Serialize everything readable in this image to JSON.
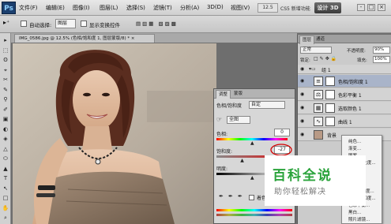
{
  "app": {
    "logo_text": "Ps",
    "menu": [
      "文件(F)",
      "编辑(E)",
      "图像(I)",
      "图层(L)",
      "选择(S)",
      "滤镜(T)",
      "分析(A)",
      "3D(D)",
      "视图(V)"
    ],
    "zoom": "12.5",
    "version_label": "CS5 新增功能",
    "workspace_label": "设计 3D",
    "window_buttons": [
      "-",
      "□",
      "×"
    ]
  },
  "options_bar": {
    "tool_icon": "move-tool-icon",
    "auto_select_label": "自动选择:",
    "auto_select_value": "图层",
    "show_transform_label": "显示变换控件"
  },
  "document": {
    "tab_title": "IMG_0586.jpg @ 12.5% (色相/饱和度 1, 图层蒙版/8) * ×"
  },
  "toolbox": {
    "tools": [
      "▸",
      "⬚",
      "ʘ",
      "⌖",
      "✂",
      "✎",
      "⚲",
      "✐",
      "▣",
      "◐",
      "◈",
      "△",
      "⬭",
      "▲",
      "T",
      "↖",
      "□",
      "✋",
      "⌕"
    ]
  },
  "adjustments": {
    "tabs": [
      "调整",
      "蒙版"
    ],
    "preset_label": "色相/饱和度",
    "preset_value": "自定",
    "channel_value": "全图",
    "hue_label": "色相:",
    "hue_value": "0",
    "saturation_label": "饱和度:",
    "saturation_value": "-27",
    "saturation_fraction": 0.37,
    "lightness_label": "明度:",
    "lightness_value": "0",
    "colorize_label": "着色",
    "highlight_color": "#d40000"
  },
  "layers": {
    "tabs": [
      "图层",
      "通道"
    ],
    "blend_mode": "正常",
    "opacity_label": "不透明度:",
    "opacity_value": "90%",
    "lock_label": "锁定:",
    "fill_label": "填充:",
    "fill_value": "100%",
    "group_name": "组 1",
    "items": [
      {
        "name": "色相/饱和度 1",
        "thumb": "≡",
        "selected": true
      },
      {
        "name": "色彩平衡 1",
        "thumb": "⚖",
        "selected": false
      },
      {
        "name": "选取颜色 1",
        "thumb": "▦",
        "selected": false
      },
      {
        "name": "曲线 1",
        "thumb": "∿",
        "selected": false
      },
      {
        "name": "背景",
        "thumb": "",
        "selected": false
      }
    ]
  },
  "context_menu": {
    "items": [
      "纯色...",
      "渐变...",
      "图案...",
      "亮度/对比度...",
      "色阶...",
      "曲线...",
      "曝光度...",
      "自然饱和度...",
      "色相/饱和度...",
      "色彩平衡...",
      "黑白...",
      "照片滤镜..."
    ]
  },
  "watermark": {
    "title": "百科全说",
    "subtitle": "助你轻松解决",
    "color": "#2aa33b"
  }
}
